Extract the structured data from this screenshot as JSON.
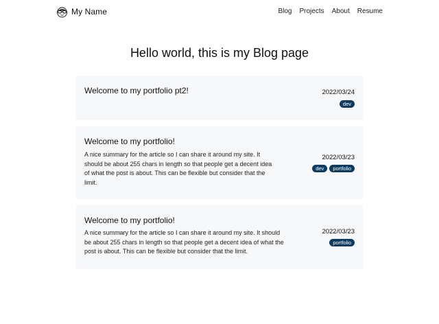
{
  "header": {
    "brand_name": "My Name",
    "brand_icon": "glasses-face-icon",
    "nav": [
      {
        "label": "Blog"
      },
      {
        "label": "Projects"
      },
      {
        "label": "About"
      },
      {
        "label": "Resume"
      }
    ]
  },
  "main": {
    "title": "Hello world, this is my Blog page",
    "posts": [
      {
        "title": "Welcome to my portfolio pt2!",
        "summary": "",
        "date": "2022/03/24",
        "tags": [
          "dev"
        ]
      },
      {
        "title": "Welcome to my portfolio!",
        "summary": "A nice summary for the article so I can share it around my site. It should be about 255 chars in length so that people get a decent idea of what the post is about. This can be flexible but consider that the limit.",
        "date": "2022/03/23",
        "tags": [
          "dev",
          "portfolio"
        ]
      },
      {
        "title": "Welcome to my portfolio!",
        "summary": "A nice summary for the article so I can share it around my site. It should be about 255 chars in length so that people get a decent idea of what the post is about. This can be flexible but consider that the limit.",
        "date": "2022/03/23",
        "tags": [
          "portfolio"
        ]
      }
    ]
  },
  "colors": {
    "card_background": "#f7f8fa",
    "tag_background": "#0d3b5f",
    "tag_text": "#ffffff"
  }
}
